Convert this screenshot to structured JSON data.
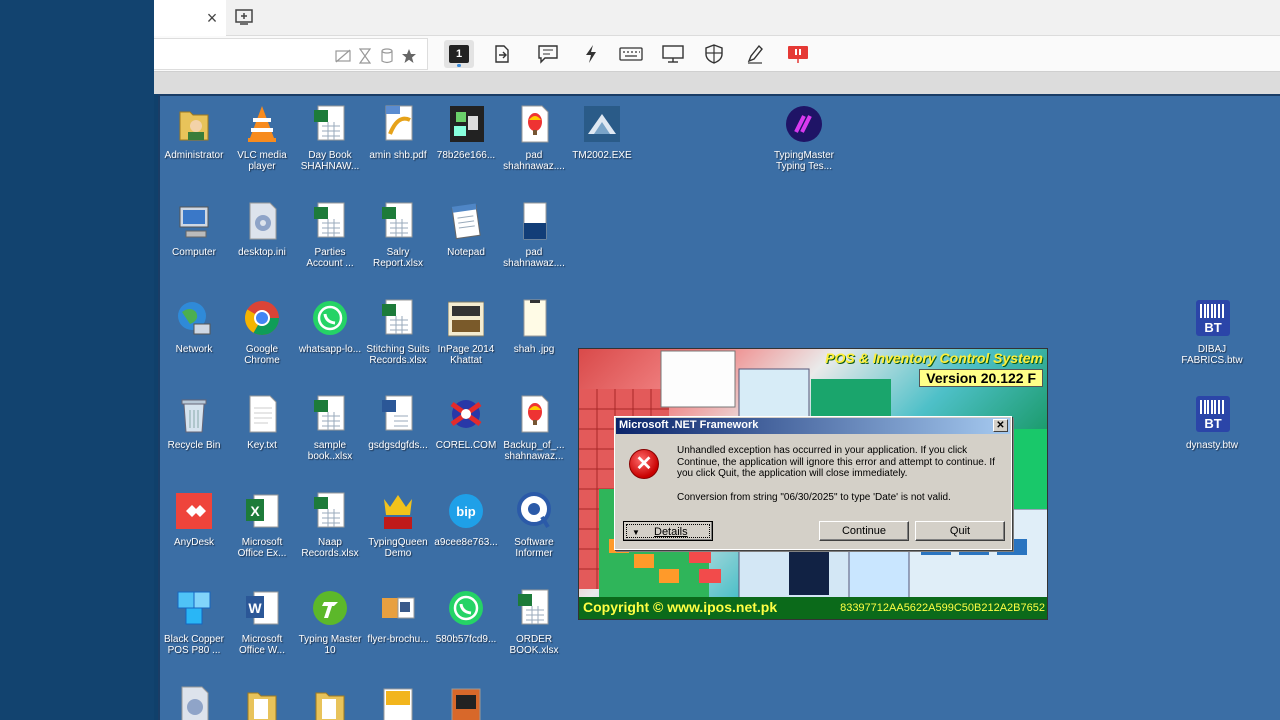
{
  "toolbar": {
    "page_number": "1"
  },
  "desktop_icons": [
    {
      "label": "Administrator"
    },
    {
      "label": "VLC media player"
    },
    {
      "label": "Day Book SHAHNAW..."
    },
    {
      "label": "amin shb.pdf"
    },
    {
      "label": "78b26e166..."
    },
    {
      "label": "pad shahnawaz...."
    },
    {
      "label": "TM2002.EXE"
    },
    {
      "label": "TypingMaster Typing Tes..."
    },
    {
      "label": "Computer"
    },
    {
      "label": "desktop.ini"
    },
    {
      "label": "Parties Account ..."
    },
    {
      "label": "Salry Report.xlsx"
    },
    {
      "label": "Notepad"
    },
    {
      "label": "pad shahnawaz...."
    },
    {
      "label": "Network"
    },
    {
      "label": "Google Chrome"
    },
    {
      "label": "whatsapp-lo..."
    },
    {
      "label": "Stitching Suits Records.xlsx"
    },
    {
      "label": "InPage 2014 Khattat"
    },
    {
      "label": "shah .jpg"
    },
    {
      "label": "DIBAJ FABRICS.btw"
    },
    {
      "label": "Recycle Bin"
    },
    {
      "label": "Key.txt"
    },
    {
      "label": "sample book..xlsx"
    },
    {
      "label": "gsdgsdgfds..."
    },
    {
      "label": "COREL.COM"
    },
    {
      "label": "Backup_of_... shahnawaz..."
    },
    {
      "label": "dynasty.btw"
    },
    {
      "label": "AnyDesk"
    },
    {
      "label": "Microsoft Office Ex..."
    },
    {
      "label": "Naap Records.xlsx"
    },
    {
      "label": "TypingQueen Demo"
    },
    {
      "label": "a9cee8e763..."
    },
    {
      "label": "Software Informer"
    },
    {
      "label": "Black Copper POS P80 ..."
    },
    {
      "label": "Microsoft Office W..."
    },
    {
      "label": "Typing Master 10"
    },
    {
      "label": "flyer-brochu..."
    },
    {
      "label": "580b57fcd9..."
    },
    {
      "label": "ORDER BOOK.xlsx"
    }
  ],
  "splash": {
    "title": "POS & Inventory Control System",
    "version": "Version 20.122 F",
    "copyright": "Copyright © www.ipos.net.pk",
    "code": "83397712AA5622A599C50B212A2B7652"
  },
  "dialog": {
    "title": "Microsoft .NET Framework",
    "close_glyph": "✕",
    "message": "Unhandled exception has occurred in your application. If you click Continue, the application will ignore this error and attempt to continue. If you click Quit, the application will close immediately.",
    "detail": "Conversion from string \"06/30/2025\" to type 'Date' is not valid.",
    "details_label": "Details",
    "continue_label": "Continue",
    "quit_label": "Quit"
  }
}
